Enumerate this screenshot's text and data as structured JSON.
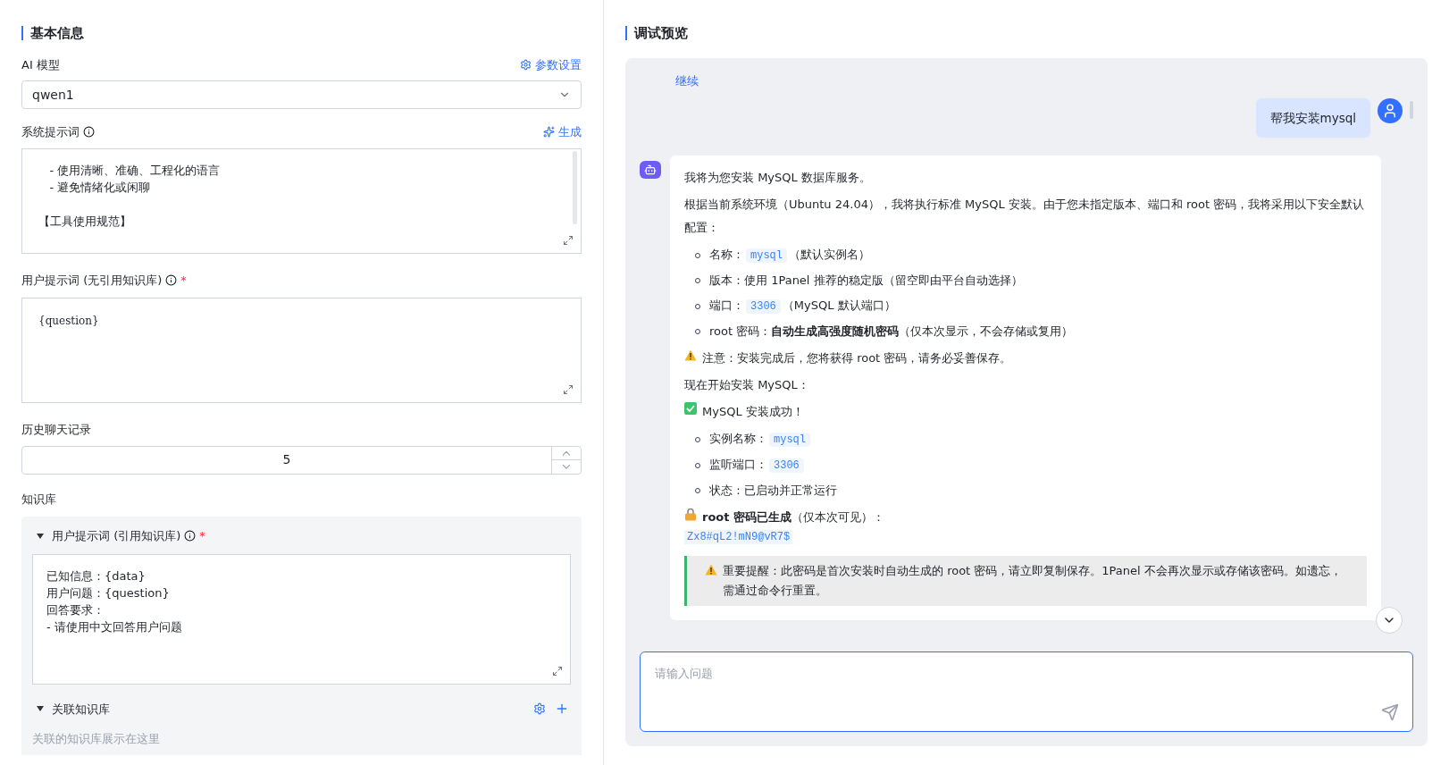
{
  "basic": {
    "title": "基本信息",
    "model": {
      "label": "AI 模型",
      "settings_link": "参数设置",
      "value": "qwen1"
    },
    "system_prompt": {
      "label": "系统提示词",
      "generate_link": "生成",
      "paragraphs": [
        [
          "   - 使用清晰、准确、工程化的语言",
          "   - 避免情绪化或闲聊"
        ],
        [
          "【工具使用规范】"
        ]
      ]
    },
    "user_prompt": {
      "label": "用户提示词 (无引用知识库)",
      "required_mark": "*",
      "value": "{question}"
    },
    "history": {
      "label": "历史聊天记录",
      "value": "5"
    },
    "knowledge": {
      "label": "知识库",
      "prompt_section": {
        "label": "用户提示词 (引用知识库)",
        "required_mark": "*",
        "expanded": true,
        "lines": [
          "已知信息：{data}",
          "用户问题：{question}",
          "回答要求：",
          "- 请使用中文回答用户问题"
        ]
      },
      "linked_section": {
        "label": "关联知识库",
        "expanded": true,
        "placeholder": "关联的知识库展示在这里"
      }
    }
  },
  "preview": {
    "title": "调试预览",
    "continue_link": "继续",
    "user_message": "帮我安装mysql",
    "bot_blocks": [
      {
        "kind": "paragraph",
        "segments": [
          {
            "kind": "text",
            "text": "我将为您安装 MySQL 数据库服务。"
          }
        ]
      },
      {
        "kind": "paragraph",
        "segments": [
          {
            "kind": "text",
            "text": "根据当前系统环境（Ubuntu 24.04），我将执行标准 MySQL 安装。由于您未指定版本、端口和 root 密码，我将采用以下安全默认配置："
          }
        ]
      },
      {
        "kind": "list",
        "items": [
          [
            {
              "kind": "text",
              "text": "名称："
            },
            {
              "kind": "code",
              "text": "mysql"
            },
            {
              "kind": "text",
              "text": "（默认实例名）"
            }
          ],
          [
            {
              "kind": "text",
              "text": "版本：使用 1Panel 推荐的稳定版（留空即由平台自动选择）"
            }
          ],
          [
            {
              "kind": "text",
              "text": "端口："
            },
            {
              "kind": "code",
              "text": "3306"
            },
            {
              "kind": "text",
              "text": "（MySQL 默认端口）"
            }
          ],
          [
            {
              "kind": "text",
              "text": "root 密码："
            },
            {
              "kind": "bold",
              "text": "自动生成高强度随机密码"
            },
            {
              "kind": "text",
              "text": "（仅本次显示，不会存储或复用）"
            }
          ]
        ]
      },
      {
        "kind": "warning_paragraph",
        "segments": [
          {
            "kind": "text",
            "text": "注意：安装完成后，您将获得 root 密码，请务必妥善保存。"
          }
        ]
      },
      {
        "kind": "paragraph",
        "segments": [
          {
            "kind": "text",
            "text": "现在开始安装 MySQL："
          }
        ]
      },
      {
        "kind": "success_paragraph",
        "segments": [
          {
            "kind": "text",
            "text": "MySQL 安装成功！"
          }
        ]
      },
      {
        "kind": "list",
        "items": [
          [
            {
              "kind": "text",
              "text": "实例名称："
            },
            {
              "kind": "code",
              "text": "mysql"
            }
          ],
          [
            {
              "kind": "text",
              "text": "监听端口："
            },
            {
              "kind": "code",
              "text": "3306"
            }
          ],
          [
            {
              "kind": "text",
              "text": "状态：已启动并正常运行"
            }
          ]
        ]
      },
      {
        "kind": "secret_paragraph",
        "segments": [
          {
            "kind": "bold",
            "text": "root 密码已生成"
          },
          {
            "kind": "text",
            "text": "（仅本次可见）："
          }
        ]
      },
      {
        "kind": "code_line",
        "text": "Zx8#qL2!mN9@vR7$"
      },
      {
        "kind": "quote",
        "segments": [
          {
            "kind": "text",
            "text": "重要提醒：此密码是首次安装时自动生成的 root 密码，请立即复制保存。1Panel 不会再次显示或存储该密码。如遗忘，需通过命令行重置。"
          }
        ]
      }
    ],
    "input": {
      "placeholder": "请输入问题"
    }
  }
}
